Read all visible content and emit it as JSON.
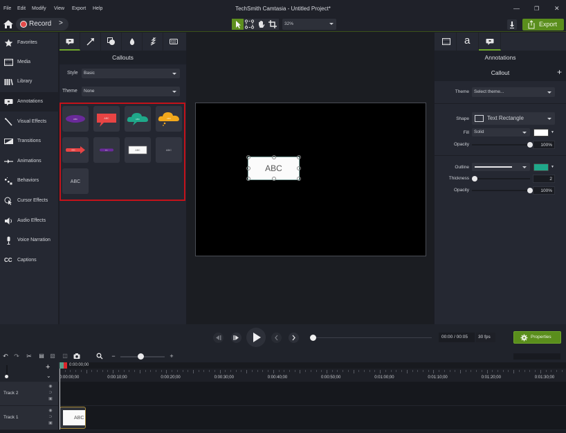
{
  "app": {
    "title": "TechSmith Camtasia - Untitled Project*",
    "menu": [
      "File",
      "Edit",
      "Modify",
      "View",
      "Export",
      "Help"
    ],
    "window_controls": [
      "minimize",
      "restore",
      "close"
    ]
  },
  "toolbar": {
    "record_label": "Record",
    "record_more": ">",
    "tools": [
      {
        "name": "select-tool",
        "icon": "arrow-pointer-icon",
        "active": true
      },
      {
        "name": "edit-points-tool",
        "icon": "edit-points-icon",
        "active": false
      },
      {
        "name": "pan-tool",
        "icon": "hand-icon",
        "active": false
      },
      {
        "name": "crop-tool",
        "icon": "crop-icon",
        "active": false
      }
    ],
    "zoom_value": "32%",
    "export_label": "Export",
    "accent_color": "#5a8e1c"
  },
  "sidebar": {
    "items": [
      {
        "label": "Favorites",
        "icon": "star-icon",
        "active": false
      },
      {
        "label": "Media",
        "icon": "film-icon",
        "active": false
      },
      {
        "label": "Library",
        "icon": "library-icon",
        "active": false
      },
      {
        "label": "Annotations",
        "icon": "annotation-icon",
        "active": true
      },
      {
        "label": "Visual Effects",
        "icon": "magic-wand-icon",
        "active": false
      },
      {
        "label": "Transitions",
        "icon": "transition-icon",
        "active": false
      },
      {
        "label": "Animations",
        "icon": "animation-icon",
        "active": false
      },
      {
        "label": "Behaviors",
        "icon": "behaviors-icon",
        "active": false
      },
      {
        "label": "Cursor Effects",
        "icon": "cursor-effects-icon",
        "active": false
      },
      {
        "label": "Audio Effects",
        "icon": "speaker-icon",
        "active": false
      },
      {
        "label": "Voice Narration",
        "icon": "microphone-icon",
        "active": false
      },
      {
        "label": "Captions",
        "icon": "cc-icon",
        "active": false
      }
    ]
  },
  "library": {
    "tabs": [
      {
        "icon": "callout-icon",
        "active": true
      },
      {
        "icon": "arrow-line-icon",
        "active": false
      },
      {
        "icon": "shapes-icon",
        "active": false
      },
      {
        "icon": "blur-drop-icon",
        "active": false
      },
      {
        "icon": "sketch-motion-icon",
        "active": false
      },
      {
        "icon": "keyboard-icon",
        "active": false
      }
    ],
    "title": "Callouts",
    "style_label": "Style",
    "style_value": "Basic",
    "theme_label": "Theme",
    "theme_value": "None",
    "callouts": [
      {
        "name": "purple-pill-callout",
        "text": "ABC",
        "color": "#6a2a9a"
      },
      {
        "name": "red-speech-callout",
        "text": "ABC",
        "color": "#e84444"
      },
      {
        "name": "teal-cloud-callout",
        "text": "ABC",
        "color": "#1fa88a"
      },
      {
        "name": "orange-thought-callout",
        "text": "ABC",
        "color": "#f2a81c"
      },
      {
        "name": "red-arrow-callout",
        "text": "ABC",
        "color": "#e84444"
      },
      {
        "name": "purple-small-pill-callout",
        "text": "ABC",
        "color": "#6a2a9a"
      },
      {
        "name": "text-rectangle-callout",
        "text": "ABC",
        "color": "#ffffff"
      },
      {
        "name": "small-text-callout",
        "text": "ABC",
        "color": ""
      },
      {
        "name": "large-text-callout",
        "text": "ABC",
        "color": ""
      }
    ],
    "highlight_color": "#c4121a"
  },
  "canvas": {
    "callout_text": "ABC"
  },
  "properties": {
    "tabs": [
      {
        "icon": "film-icon",
        "active": false
      },
      {
        "icon": "text-a-icon",
        "label": "a",
        "active": false
      },
      {
        "icon": "callout-icon",
        "active": true
      }
    ],
    "section": "Annotations",
    "subsection": "Callout",
    "add_label": "+",
    "theme_label": "Theme",
    "theme_placeholder": "Select theme...",
    "shape_label": "Shape",
    "shape_value": "Text Rectangle",
    "fill_label": "Fill",
    "fill_value": "Solid",
    "fill_color": "#ffffff",
    "fill_opacity_label": "Opacity",
    "fill_opacity": "100%",
    "fill_opacity_fraction": 1.0,
    "outline_label": "Outline",
    "outline_color": "#1fa88a",
    "thickness_label": "Thickness",
    "thickness_value": "2",
    "thickness_fraction": 0.0,
    "outline_opacity_label": "Opacity",
    "outline_opacity": "100%",
    "outline_opacity_fraction": 1.0
  },
  "playback": {
    "time": "00:00 / 00:05",
    "fps": "30 fps",
    "progress_fraction": 0.0,
    "properties_label": "Properties"
  },
  "timeline": {
    "playhead_time": "0:00:00;00",
    "zoom_fraction": 0.45,
    "ruler_labels": [
      "0:00:00;00",
      "0:00:10;00",
      "0:00:20;00",
      "0:00:30;00",
      "0:00:40;00",
      "0:00:50;00",
      "0:01:00;00",
      "0:01:10;00",
      "0:01:20;00",
      "0:01:30;00"
    ],
    "tracks": [
      {
        "name": "Track 2",
        "clips": []
      },
      {
        "name": "Track 1",
        "clips": [
          {
            "text": "ABC"
          }
        ]
      }
    ]
  }
}
